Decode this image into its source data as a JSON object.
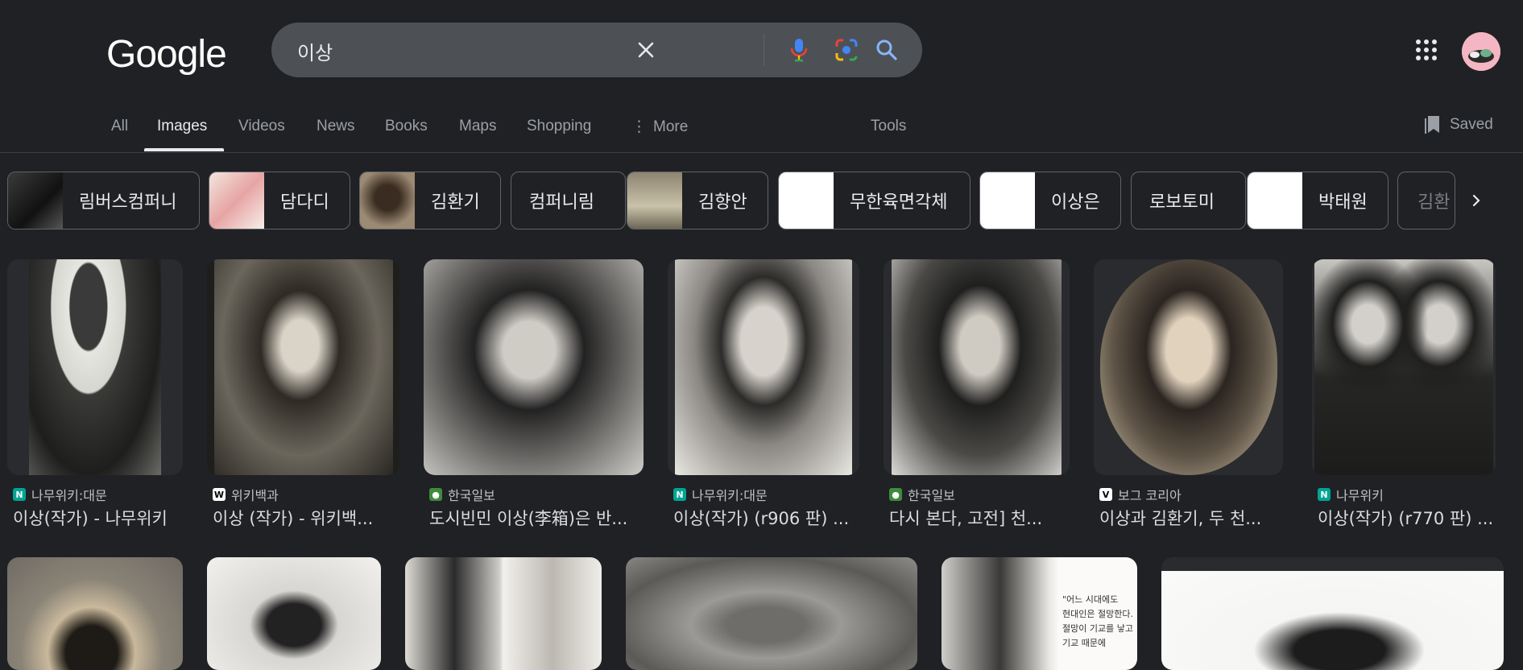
{
  "logo": "Google",
  "search": {
    "query": "이상"
  },
  "tabs": [
    "All",
    "Images",
    "Videos",
    "News",
    "Books",
    "Maps",
    "Shopping",
    "More",
    "Tools"
  ],
  "saved_label": "Saved",
  "chips": [
    "림버스컴퍼니",
    "담다디",
    "김환기",
    "컴퍼니림",
    "김향안",
    "무한육면각체",
    "이상은",
    "로보토미",
    "박태원",
    "김환"
  ],
  "results": [
    {
      "source": "나무위키:대문",
      "title": "이상(작가) - 나무위키",
      "favicon": "namu-icon"
    },
    {
      "source": "위키백과",
      "title": "이상 (작가) - 위키백...",
      "favicon": "wikipedia-icon"
    },
    {
      "source": "한국일보",
      "title": "도시빈민 이상(李箱)은 반...",
      "favicon": "hankook-icon"
    },
    {
      "source": "나무위키:대문",
      "title": "이상(작가) (r906 판) ...",
      "favicon": "namu-icon"
    },
    {
      "source": "한국일보",
      "title": "다시 본다, 고전] 천...",
      "favicon": "hankook-icon"
    },
    {
      "source": "보그 코리아",
      "title": "이상과 김환기, 두 천...",
      "favicon": "vogue-icon"
    },
    {
      "source": "나무위키",
      "title": "이상(작가) (r770 판) ...",
      "favicon": "namu-icon"
    }
  ],
  "photo_caption_lines": [
    "\"어느 시대에도",
    "현대인은 절망한다.",
    "절망이 기교를 낳고",
    "기교 때문에"
  ],
  "colors": {
    "bg": "#202124",
    "search_bg": "#4d5156",
    "accent_blue": "#8ab4f8"
  }
}
